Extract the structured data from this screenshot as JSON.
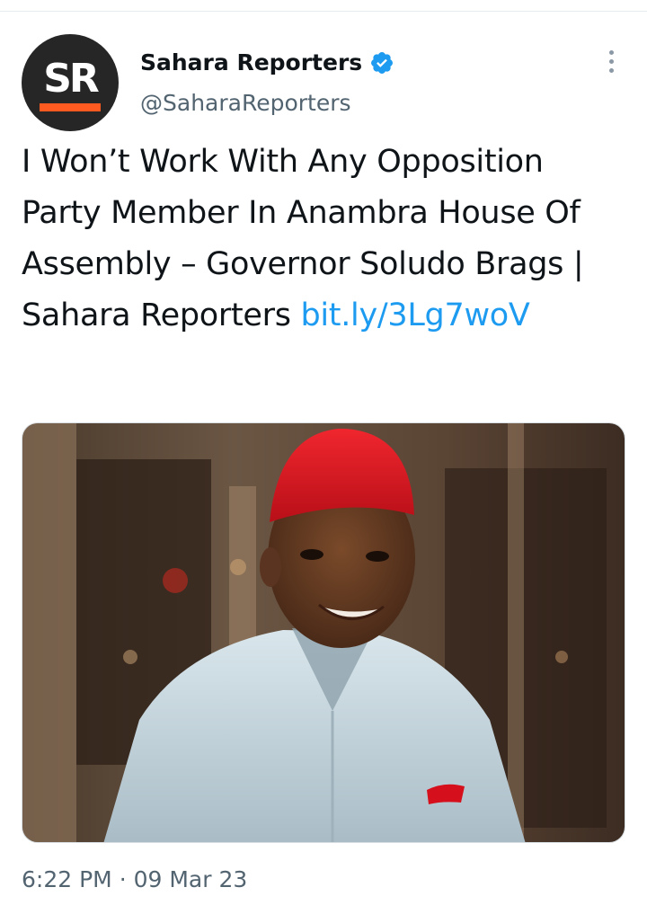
{
  "account": {
    "avatar_text": "SR",
    "display_name": "Sahara Reporters",
    "handle": "@SaharaReporters",
    "verified": true
  },
  "tweet": {
    "text": "I Won’t Work With Any Opposition Party Member In Anambra House Of Assembly – Governor Soludo Brags | Sahara Reporters ",
    "link": "bit.ly/3Lg7woV",
    "time": "6:22 PM",
    "separator": "·",
    "date": "09 Mar 23"
  },
  "media": {
    "description_icon": "photo-of-man-in-red-cap"
  },
  "colors": {
    "link": "#1d9bf0",
    "secondary_text": "#536471",
    "verified": "#1d9bf0",
    "avatar_bg": "#262626",
    "avatar_accent": "#ff5a1f",
    "cap_red": "#e01b24"
  }
}
